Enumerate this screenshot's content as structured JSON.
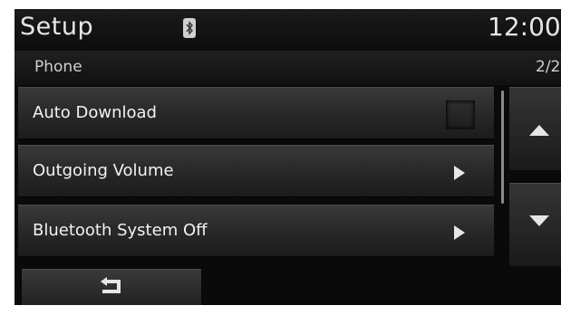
{
  "header": {
    "title": "Setup",
    "clock": "12:00",
    "status_icon": "bluetooth-icon"
  },
  "subheader": {
    "section": "Phone",
    "page": "2/2"
  },
  "menu": {
    "items": [
      {
        "label": "Auto Download",
        "control": "checkbox",
        "checked": false
      },
      {
        "label": "Outgoing Volume",
        "control": "arrow-right"
      },
      {
        "label": "Bluetooth System Off",
        "control": "arrow-right"
      }
    ]
  },
  "side_buttons": {
    "up_icon": "scroll-up-icon",
    "down_icon": "scroll-down-icon"
  },
  "footer": {
    "back_icon": "back-return-icon"
  },
  "colors": {
    "background": "#0a0a0a",
    "row": "#2a2a2a",
    "text": "#f2f2f2",
    "subtext": "#cfcfcf"
  }
}
